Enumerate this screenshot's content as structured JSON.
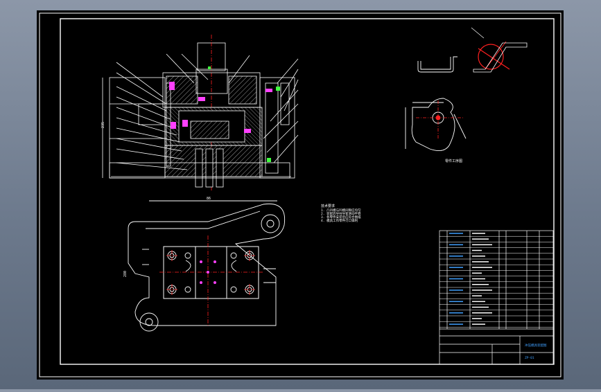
{
  "drawing": {
    "tech_requirements_title": "技术要求",
    "tech_requirements": [
      "1. 凸凹模与凹模间隙应均匀",
      "2. 装配后导柱导套滑动平稳",
      "3. 各零件安装后应符合图纸",
      "4. 模具工作零件刃口锋利"
    ],
    "part_view_caption": "零件工序图",
    "dimension_top": "86",
    "dimension_side": "280",
    "dimension_height": "235",
    "title_block_name": "冲压模具装配图",
    "title_block_code": "ZP-01",
    "colors": {
      "background": "#000000",
      "line": "#ffffff",
      "center_line": "#ff2020",
      "accent_magenta": "#ff40ff",
      "accent_green": "#40ff40",
      "accent_cyan": "#40a0ff",
      "border": "#ffffff"
    }
  }
}
